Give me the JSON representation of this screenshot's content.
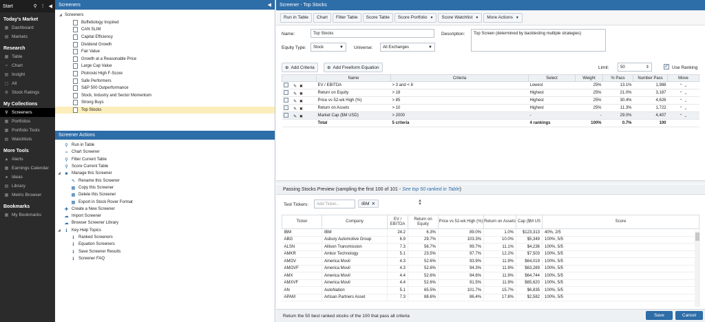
{
  "nav": {
    "start": "Start",
    "sections": {
      "todays_market": "Today's Market",
      "research": "Research",
      "my_collections": "My Collections",
      "more_tools": "More Tools",
      "bookmarks": "Bookmarks"
    },
    "dashboard": "Dashboard",
    "markets": "Markets",
    "table": "Table",
    "chart": "Chart",
    "insight": "Insight",
    "all": "All",
    "stock_ratings": "Stock Ratings",
    "screeners": "Screeners",
    "portfolios": "Portfolios",
    "portfolio_tools": "Portfolio Tools",
    "watchlists": "Watchlists",
    "alerts": "Alerts",
    "earnings_calendar": "Earnings Calendar",
    "ideas": "Ideas",
    "library": "Library",
    "metric_browser": "Metric Browser",
    "my_bookmarks": "My Bookmarks"
  },
  "screeners_panel": {
    "title": "Screeners",
    "root": "Screeners",
    "items": [
      "Buffettology Inspired",
      "CAN SLIM",
      "Capital Efficiency",
      "Dividend Growth",
      "Fair Value",
      "Growth at a Reasonable Price",
      "Large Cap Value",
      "Piotroski High F-Score",
      "Safe Performers",
      "S&P 500 Outperformance",
      "Stock, Industry and Sector Momentum",
      "Strong Buys",
      "Top Stocks"
    ]
  },
  "actions_panel": {
    "title": "Screener Actions",
    "run_in_table": "Run in Table",
    "chart_screener": "Chart Screener",
    "filter_current_table": "Filter Current Table",
    "score_current_table": "Score Current Table",
    "manage": "Manage this Screener",
    "rename": "Rename this Screener",
    "copy": "Copy this Screener",
    "delete": "Delete this Screener",
    "export": "Export in Stock Rover Format",
    "create": "Create a New Screener",
    "import": "Import Screener",
    "browser_library": "Browser Screener Library",
    "key_help": "Key Help Topics",
    "ranked_screeners": "Ranked Screeners",
    "equation_screeners": "Equation Screeners",
    "save_results": "Save Screener Results",
    "faq": "Screener FAQ"
  },
  "editor": {
    "title": "Screener - Top Stocks",
    "toolbar": {
      "run_in_table": "Run in Table",
      "chart": "Chart",
      "filter_table": "Filter Table",
      "score_table": "Score Table",
      "score_portfolio": "Score Portfolio",
      "score_watchlist": "Score Watchlist",
      "more_actions": "More Actions"
    },
    "name_label": "Name:",
    "name_value": "Top Stocks",
    "description_label": "Description:",
    "description_value": "Top Screen (determined by backtesting multiple strategies)",
    "equity_type_label": "Equity Type:",
    "equity_type_value": "Stock",
    "universe_label": "Universe:",
    "universe_value": "All Exchanges",
    "add_criteria": "Add Criteria",
    "add_freeform": "Add Freeform Equation",
    "limit_label": "Limit:",
    "limit_value": "50",
    "use_ranking": "Use Ranking"
  },
  "criteria": {
    "headers": [
      "Name",
      "Criteria",
      "Select",
      "Weight",
      "% Pass",
      "Number Pass",
      "Move"
    ],
    "rows": [
      {
        "name": "EV / EBITDA",
        "criteria": "> 3 and < 8",
        "select": "Lowest",
        "weight": "25%",
        "pass": "13.1%",
        "number": "1,988"
      },
      {
        "name": "Return on Equity",
        "criteria": "> 18",
        "select": "Highest",
        "weight": "25%",
        "pass": "21.0%",
        "number": "3,187"
      },
      {
        "name": "Price vs 52-wk High (%)",
        "criteria": "> 85",
        "select": "Highest",
        "weight": "25%",
        "pass": "30.4%",
        "number": "4,626"
      },
      {
        "name": "Return on Assets",
        "criteria": "> 10",
        "select": "Highest",
        "weight": "25%",
        "pass": "11.3%",
        "number": "1,722"
      },
      {
        "name": "Market Cap ($M USD)",
        "criteria": "> 2000",
        "select": "-",
        "weight": "-",
        "pass": "29.0%",
        "number": "4,407"
      }
    ],
    "total": {
      "label": "Total",
      "criteria": "5 criteria",
      "select": "4 rankings",
      "weight": "100%",
      "pass": "0.7%",
      "number": "100"
    }
  },
  "preview": {
    "title_prefix": "Passing Stocks Preview (sampling the first 100 of 101 - ",
    "title_link": "See top 50 ranked in Table",
    "title_suffix": ")",
    "test_tickers_label": "Test Tickers:",
    "test_tickers_placeholder": "Add Ticker...",
    "test_ticker_tag": "IBM",
    "headers": [
      "Ticker",
      "Company",
      "EV / EBITDA",
      "Return on Equity",
      "Price vs 52-wk High (%)",
      "Return on Assets",
      "Cap ($M US",
      "Score"
    ],
    "rows": [
      [
        "IBM",
        "IBM",
        "24.2",
        "6.3%",
        "89.0%",
        "1.0%",
        "$123,313",
        "40%, 2/5"
      ],
      [
        "ABG",
        "Asbury Automotive Group",
        "6.9",
        "29.7%",
        "103.3%",
        "10.0%",
        "$5,349",
        "100%, 5/5"
      ],
      [
        "ALSN",
        "Allison Transmission",
        "7.3",
        "56.7%",
        "99.7%",
        "11.1%",
        "$4,236",
        "100%, 5/5"
      ],
      [
        "AMKR",
        "Amkor Technology",
        "5.1",
        "23.5%",
        "97.7%",
        "12.2%",
        "$7,503",
        "100%, 5/5"
      ],
      [
        "AMOV",
        "America Movil",
        "4.3",
        "52.6%",
        "93.9%",
        "11.9%",
        "$64,019",
        "100%, 5/5"
      ],
      [
        "AMOVF",
        "America Movil",
        "4.3",
        "52.6%",
        "94.3%",
        "11.9%",
        "$63,289",
        "100%, 5/5"
      ],
      [
        "AMX",
        "America Movil",
        "4.4",
        "52.6%",
        "94.6%",
        "11.9%",
        "$64,744",
        "100%, 5/5"
      ],
      [
        "AMXVF",
        "America Movil",
        "4.4",
        "52.6%",
        "91.5%",
        "11.9%",
        "$65,620",
        "100%, 5/5"
      ],
      [
        "AN",
        "AutoNation",
        "5.1",
        "65.5%",
        "101.7%",
        "15.7%",
        "$6,835",
        "100%, 5/5"
      ],
      [
        "APAM",
        "Artisan Partners Asset",
        "7.3",
        "88.6%",
        "86.4%",
        "17.8%",
        "$2,582",
        "100%, 5/5"
      ]
    ]
  },
  "status": "Return the 50 best ranked stocks of the 100 that pass all criteria",
  "buttons": {
    "save": "Save",
    "cancel": "Cancel"
  },
  "colors": {
    "accent": "#2d6da8",
    "nav_bg": "#2b2b2b",
    "selected_row": "#fbeebb"
  }
}
